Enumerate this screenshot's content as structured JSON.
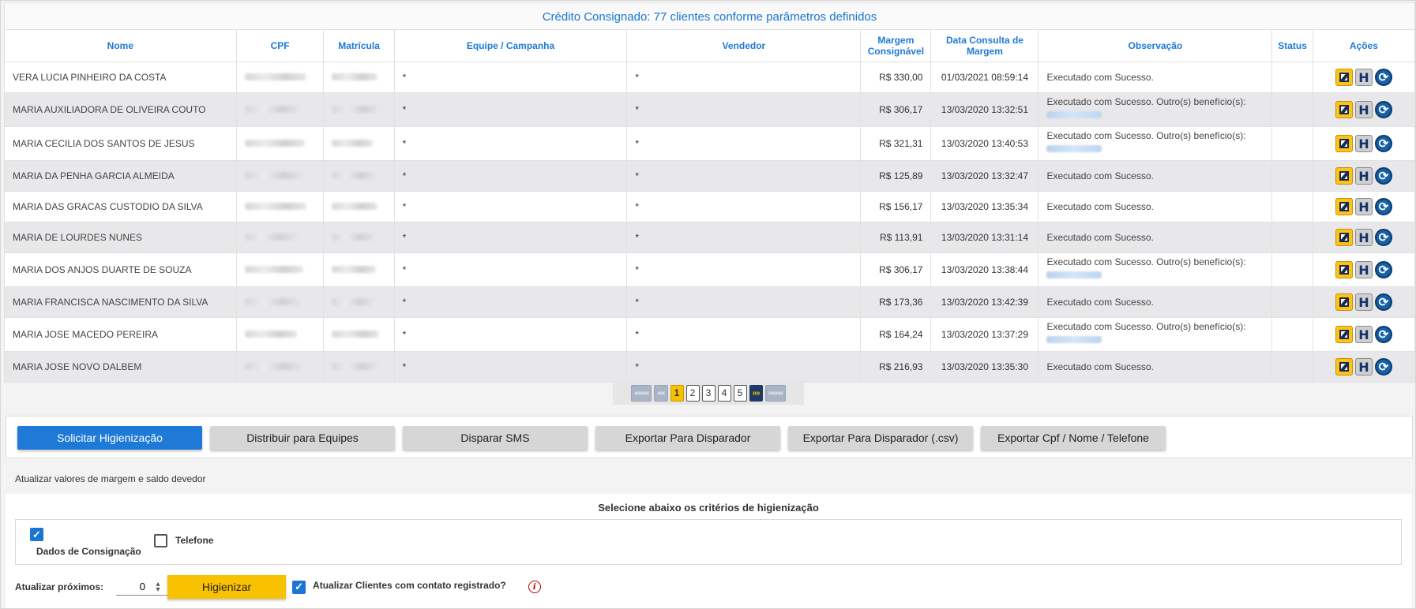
{
  "header": {
    "title": "Crédito Consignado: 77 clientes conforme parâmetros definidos"
  },
  "columns": {
    "nome": "Nome",
    "cpf": "CPF",
    "matricula": "Matrícula",
    "equipe": "Equipe / Campanha",
    "vendedor": "Vendedor",
    "margem": "Margem Consignável",
    "data": "Data Consulta de Margem",
    "obs": "Observação",
    "status": "Status",
    "acoes": "Ações"
  },
  "rows": [
    {
      "nome": "VERA LUCIA PINHEIRO DA COSTA",
      "equipe": "*",
      "vendedor": "*",
      "margem": "R$ 330,00",
      "data": "01/03/2021 08:59:14",
      "obs": "Executado com Sucesso."
    },
    {
      "nome": "MARIA AUXILIADORA DE OLIVEIRA COUTO",
      "equipe": "*",
      "vendedor": "*",
      "margem": "R$ 306,17",
      "data": "13/03/2020 13:32:51",
      "obs": "Executado com Sucesso. Outro(s) benefício(s):"
    },
    {
      "nome": "MARIA CECILIA DOS SANTOS DE JESUS",
      "equipe": "*",
      "vendedor": "*",
      "margem": "R$ 321,31",
      "data": "13/03/2020 13:40:53",
      "obs": "Executado com Sucesso. Outro(s) benefício(s):"
    },
    {
      "nome": "MARIA DA PENHA GARCIA ALMEIDA",
      "equipe": "*",
      "vendedor": "*",
      "margem": "R$ 125,89",
      "data": "13/03/2020 13:32:47",
      "obs": "Executado com Sucesso."
    },
    {
      "nome": "MARIA DAS GRACAS CUSTODIO DA SILVA",
      "equipe": "*",
      "vendedor": "*",
      "margem": "R$ 156,17",
      "data": "13/03/2020 13:35:34",
      "obs": "Executado com Sucesso."
    },
    {
      "nome": "MARIA DE LOURDES NUNES",
      "equipe": "*",
      "vendedor": "*",
      "margem": "R$ 113,91",
      "data": "13/03/2020 13:31:14",
      "obs": "Executado com Sucesso."
    },
    {
      "nome": "MARIA DOS ANJOS DUARTE DE SOUZA",
      "equipe": "*",
      "vendedor": "*",
      "margem": "R$ 306,17",
      "data": "13/03/2020 13:38:44",
      "obs": "Executado com Sucesso. Outro(s) benefício(s):"
    },
    {
      "nome": "MARIA FRANCISCA NASCIMENTO DA SILVA",
      "equipe": "*",
      "vendedor": "*",
      "margem": "R$ 173,36",
      "data": "13/03/2020 13:42:39",
      "obs": "Executado com Sucesso."
    },
    {
      "nome": "MARIA JOSE MACEDO PEREIRA",
      "equipe": "*",
      "vendedor": "*",
      "margem": "R$ 164,24",
      "data": "13/03/2020 13:37:29",
      "obs": "Executado com Sucesso. Outro(s) benefício(s):"
    },
    {
      "nome": "MARIA JOSE NOVO DALBEM",
      "equipe": "*",
      "vendedor": "*",
      "margem": "R$ 216,93",
      "data": "13/03/2020 13:35:30",
      "obs": "Executado com Sucesso."
    }
  ],
  "pagination": {
    "first": "««««",
    "prev": "««",
    "pages": [
      "1",
      "2",
      "3",
      "4",
      "5"
    ],
    "current": "1",
    "next": "»»",
    "last": "»»»»"
  },
  "actions": {
    "solicitar": "Solicitar Higienização",
    "distribuir": "Distribuir para Equipes",
    "sms": "Disparar SMS",
    "exportar": "Exportar Para Disparador",
    "exportar_csv": "Exportar Para Disparador (.csv)",
    "exportar_cpf": "Exportar Cpf / Nome / Telefone"
  },
  "update_section": {
    "title": "Atualizar valores de margem e saldo devedor"
  },
  "hygiene": {
    "title": "Selecione abaixo os critérios de higienização",
    "dados_label": "Dados de Consignação",
    "dados_checked": true,
    "telefone_label": "Telefone",
    "telefone_checked": false,
    "proximos_label": "Atualizar próximos:",
    "proximos_value": "0",
    "higienizar": "Higienizar",
    "contato_label": "Atualizar Clientes com contato registrado?",
    "contato_checked": true
  },
  "icons": {
    "edit": "edit-icon",
    "history": "history-h-icon",
    "refresh": "refresh-icon",
    "info": "info-icon"
  },
  "colors": {
    "primary": "#1e7ad6",
    "accent": "#f9c200",
    "header_text": "#1976d2"
  }
}
